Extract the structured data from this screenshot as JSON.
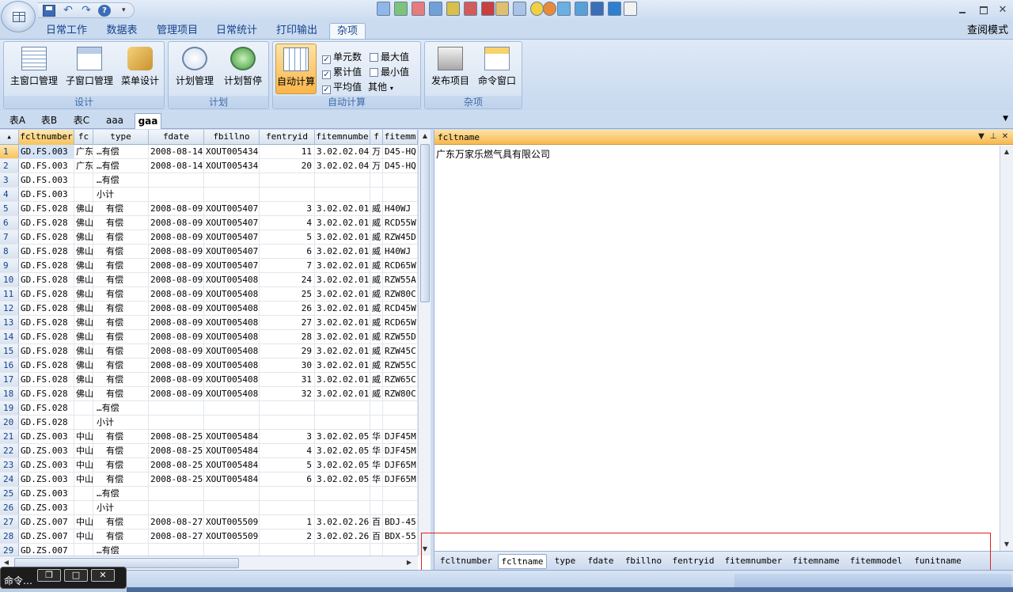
{
  "ribbon_tabs": [
    "日常工作",
    "数据表",
    "管理项目",
    "日常统计",
    "打印输出",
    "杂项"
  ],
  "read_mode": "查阅模式",
  "groups": {
    "design": {
      "label": "设计",
      "buttons": [
        "主窗口管理",
        "子窗口管理",
        "菜单设计"
      ]
    },
    "plan": {
      "label": "计划",
      "buttons": [
        "计划管理",
        "计划暂停"
      ]
    },
    "autocalc": {
      "label": "自动计算",
      "button": "自动计算",
      "checks": [
        {
          "label": "单元数",
          "checked": true
        },
        {
          "label": "最大值",
          "checked": false
        },
        {
          "label": "累计值",
          "checked": true
        },
        {
          "label": "最小值",
          "checked": false
        },
        {
          "label": "平均值",
          "checked": true
        }
      ],
      "other": "其他"
    },
    "misc": {
      "label": "杂项",
      "buttons": [
        "发布项目",
        "命令窗口"
      ]
    }
  },
  "sheet_tabs": [
    "表A",
    "表B",
    "表C",
    "aaa",
    "gaa"
  ],
  "active_sheet": "gaa",
  "grid": {
    "columns": [
      "fcltnumber",
      "fc",
      "type",
      "fdate",
      "fbillno",
      "fentryid",
      "fitemnumbe",
      "f",
      "fitemm"
    ],
    "rows": [
      [
        "1",
        "GD.FS.003",
        "广东",
        "…有偿",
        "2008-08-14",
        "XOUT005434",
        "11",
        "3.02.02.04.",
        "万",
        "D45-HQ!"
      ],
      [
        "2",
        "GD.FS.003",
        "广东",
        "…有偿",
        "2008-08-14",
        "XOUT005434",
        "20",
        "3.02.02.04.",
        "万",
        "D45-HQ!"
      ],
      [
        "3",
        "GD.FS.003",
        "",
        "…有偿",
        "",
        "",
        "",
        "",
        "",
        ""
      ],
      [
        "4",
        "GD.FS.003",
        "",
        "小计",
        "",
        "",
        "",
        "",
        "",
        ""
      ],
      [
        "5",
        "GD.FS.028",
        "佛山…",
        "有偿",
        "2008-08-09",
        "XOUT005407",
        "3",
        "3.02.02.01.",
        "威",
        "H40WJ"
      ],
      [
        "6",
        "GD.FS.028",
        "佛山…",
        "有偿",
        "2008-08-09",
        "XOUT005407",
        "4",
        "3.02.02.01.",
        "威",
        "RCD55W"
      ],
      [
        "7",
        "GD.FS.028",
        "佛山…",
        "有偿",
        "2008-08-09",
        "XOUT005407",
        "5",
        "3.02.02.01.",
        "威",
        "RZW45D"
      ],
      [
        "8",
        "GD.FS.028",
        "佛山…",
        "有偿",
        "2008-08-09",
        "XOUT005407",
        "6",
        "3.02.02.01.",
        "威",
        "H40WJ"
      ],
      [
        "9",
        "GD.FS.028",
        "佛山…",
        "有偿",
        "2008-08-09",
        "XOUT005407",
        "7",
        "3.02.02.01.",
        "威",
        "RCD65W"
      ],
      [
        "10",
        "GD.FS.028",
        "佛山…",
        "有偿",
        "2008-08-09",
        "XOUT005408",
        "24",
        "3.02.02.01.",
        "威",
        "RZW55A"
      ],
      [
        "11",
        "GD.FS.028",
        "佛山…",
        "有偿",
        "2008-08-09",
        "XOUT005408",
        "25",
        "3.02.02.01.",
        "威",
        "RZW80C"
      ],
      [
        "12",
        "GD.FS.028",
        "佛山…",
        "有偿",
        "2008-08-09",
        "XOUT005408",
        "26",
        "3.02.02.01.",
        "威",
        "RCD45W"
      ],
      [
        "13",
        "GD.FS.028",
        "佛山…",
        "有偿",
        "2008-08-09",
        "XOUT005408",
        "27",
        "3.02.02.01.",
        "威",
        "RCD65W"
      ],
      [
        "14",
        "GD.FS.028",
        "佛山…",
        "有偿",
        "2008-08-09",
        "XOUT005408",
        "28",
        "3.02.02.01.",
        "威",
        "RZW55D"
      ],
      [
        "15",
        "GD.FS.028",
        "佛山…",
        "有偿",
        "2008-08-09",
        "XOUT005408",
        "29",
        "3.02.02.01.",
        "威",
        "RZW45C"
      ],
      [
        "16",
        "GD.FS.028",
        "佛山…",
        "有偿",
        "2008-08-09",
        "XOUT005408",
        "30",
        "3.02.02.01.",
        "威",
        "RZW55C"
      ],
      [
        "17",
        "GD.FS.028",
        "佛山…",
        "有偿",
        "2008-08-09",
        "XOUT005408",
        "31",
        "3.02.02.01.",
        "威",
        "RZW65C"
      ],
      [
        "18",
        "GD.FS.028",
        "佛山…",
        "有偿",
        "2008-08-09",
        "XOUT005408",
        "32",
        "3.02.02.01.",
        "威",
        "RZW80C"
      ],
      [
        "19",
        "GD.FS.028",
        "",
        "…有偿",
        "",
        "",
        "",
        "",
        "",
        ""
      ],
      [
        "20",
        "GD.FS.028",
        "",
        "小计",
        "",
        "",
        "",
        "",
        "",
        ""
      ],
      [
        "21",
        "GD.ZS.003",
        "中山…",
        "有偿",
        "2008-08-25",
        "XOUT005484",
        "3",
        "3.02.02.05.",
        "华",
        "DJF45M"
      ],
      [
        "22",
        "GD.ZS.003",
        "中山…",
        "有偿",
        "2008-08-25",
        "XOUT005484",
        "4",
        "3.02.02.05.",
        "华",
        "DJF45M"
      ],
      [
        "23",
        "GD.ZS.003",
        "中山…",
        "有偿",
        "2008-08-25",
        "XOUT005484",
        "5",
        "3.02.02.05.",
        "华",
        "DJF65M"
      ],
      [
        "24",
        "GD.ZS.003",
        "中山…",
        "有偿",
        "2008-08-25",
        "XOUT005484",
        "6",
        "3.02.02.05.",
        "华",
        "DJF65M"
      ],
      [
        "25",
        "GD.ZS.003",
        "",
        "…有偿",
        "",
        "",
        "",
        "",
        "",
        ""
      ],
      [
        "26",
        "GD.ZS.003",
        "",
        "小计",
        "",
        "",
        "",
        "",
        "",
        ""
      ],
      [
        "27",
        "GD.ZS.007",
        "中山…",
        "有偿",
        "2008-08-27",
        "XOUT005509",
        "1",
        "3.02.02.26.",
        "百",
        "BDJ-45:"
      ],
      [
        "28",
        "GD.ZS.007",
        "中山…",
        "有偿",
        "2008-08-27",
        "XOUT005509",
        "2",
        "3.02.02.26.",
        "百",
        "BDX-55:"
      ],
      [
        "29",
        "GD.ZS.007",
        "",
        "…有偿",
        "",
        "",
        "",
        "",
        "",
        ""
      ]
    ]
  },
  "panel": {
    "title": "fcltname",
    "content": "广东万家乐燃气具有限公司",
    "field_tabs": [
      "fcltnumber",
      "fcltname",
      "type",
      "fdate",
      "fbillno",
      "fentryid",
      "fitemnumber",
      "fitemname",
      "fitemmodel",
      "funitname"
    ],
    "active_field": "fcltname"
  },
  "command_window": {
    "label": "命令…"
  },
  "icons": {
    "orb": "office-orb-icon",
    "save": "save-icon",
    "undo": "undo-icon",
    "redo": "redo-icon",
    "help": "help-icon"
  }
}
